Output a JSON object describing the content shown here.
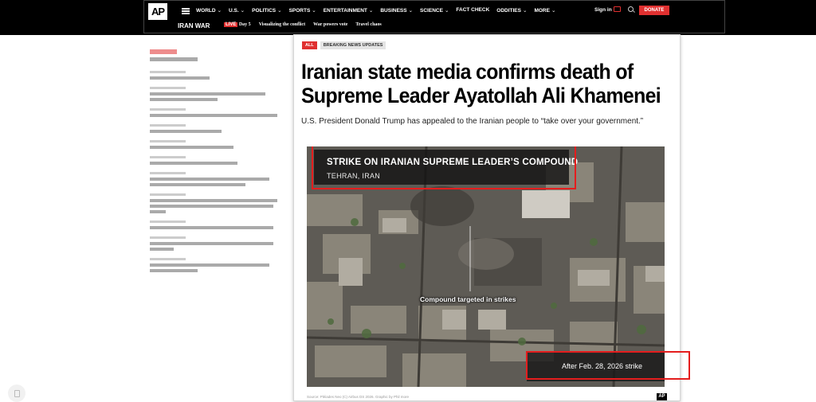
{
  "header": {
    "logo": "AP",
    "nav": [
      {
        "label": "WORLD"
      },
      {
        "label": "U.S."
      },
      {
        "label": "POLITICS"
      },
      {
        "label": "SPORTS"
      },
      {
        "label": "ENTERTAINMENT"
      },
      {
        "label": "BUSINESS"
      },
      {
        "label": "SCIENCE"
      },
      {
        "label": "FACT CHECK"
      },
      {
        "label": "ODDITIES"
      },
      {
        "label": "MORE"
      }
    ],
    "caret": "⌄",
    "signin": "Sign in",
    "donate": "DONATE",
    "section": "IRAN WAR",
    "live_badge": "LIVE",
    "day": "Day 5",
    "sub_links": [
      "Visualizing the conflict",
      "War powers vote",
      "Travel chaos"
    ]
  },
  "card": {
    "badge_all": "ALL",
    "badge_breaking": "BREAKING NEWS UPDATES",
    "headline": "Iranian state media confirms death of Supreme Leader Ayatollah Ali Khamenei",
    "dek": "U.S. President Donald Trump has appealed to the Iranian people to “take over your government.”",
    "image": {
      "title": "STRIKE ON IRANIAN SUPREME LEADER’S COMPOUND",
      "location": "TEHRAN, IRAN",
      "compound_label": "Compound targeted in strikes",
      "after_label": "After Feb. 28, 2026 strike",
      "source": "Source: Pléiades Neo (C) Airbus DS 2026. Graphic by Phil more",
      "ap_mark": "AP"
    }
  },
  "colors": {
    "accent_red": "#e03030",
    "annotation_red": "#e41d1d",
    "header_bg": "#000000"
  }
}
